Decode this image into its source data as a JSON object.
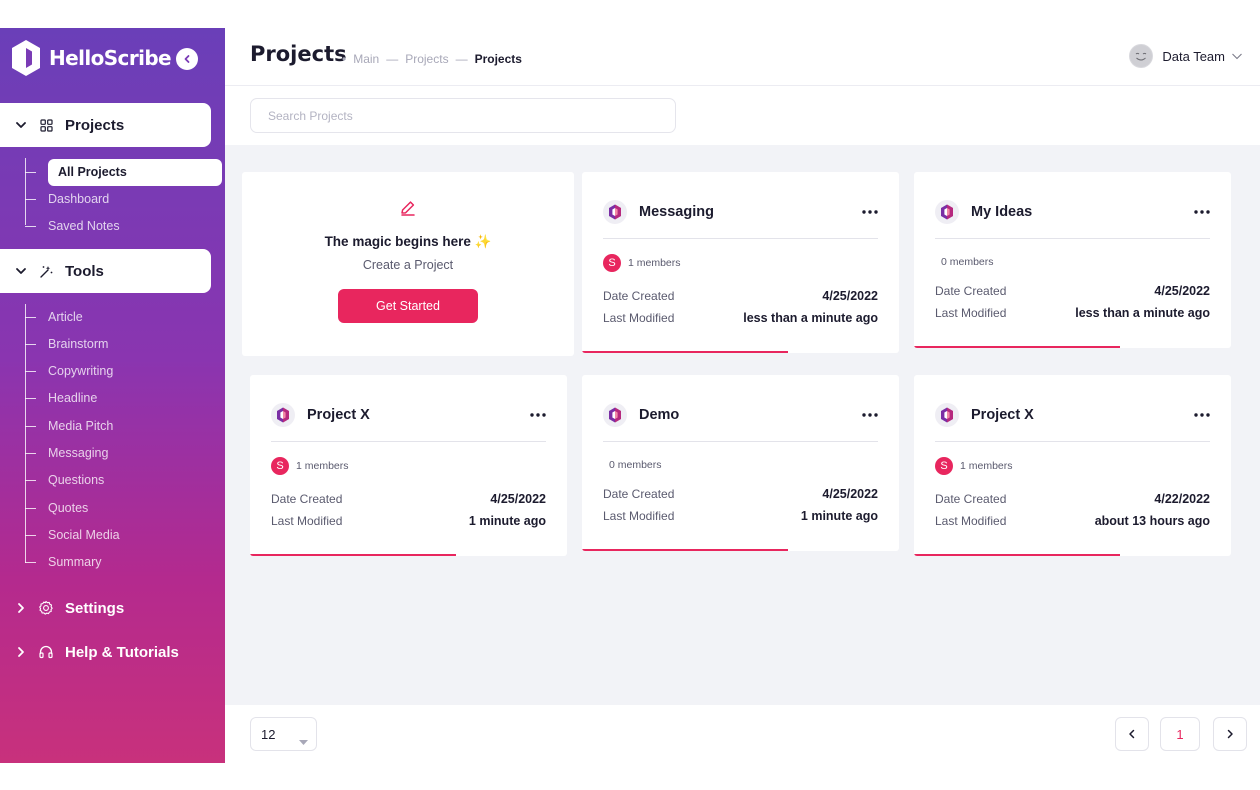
{
  "brand": {
    "name": "HelloScribe"
  },
  "colors": {
    "accent": "#e8265e",
    "sidebar_top": "#6a3fb8",
    "sidebar_bottom": "#c8317c"
  },
  "sidebar": {
    "projects": {
      "label": "Projects",
      "icon": "grid-icon",
      "items": [
        {
          "label": "All Projects",
          "active": true
        },
        {
          "label": "Dashboard"
        },
        {
          "label": "Saved Notes"
        }
      ]
    },
    "tools": {
      "label": "Tools",
      "icon": "magic-wand-icon",
      "items": [
        {
          "label": "Article"
        },
        {
          "label": "Brainstorm"
        },
        {
          "label": "Copywriting"
        },
        {
          "label": "Headline"
        },
        {
          "label": "Media Pitch"
        },
        {
          "label": "Messaging"
        },
        {
          "label": "Questions"
        },
        {
          "label": "Quotes"
        },
        {
          "label": "Social Media"
        },
        {
          "label": "Summary"
        }
      ]
    },
    "settings": {
      "label": "Settings",
      "icon": "gear-icon"
    },
    "help": {
      "label": "Help & Tutorials",
      "icon": "headset-icon"
    }
  },
  "header": {
    "title": "Projects",
    "breadcrumb": [
      "Main",
      "Projects",
      "Projects"
    ],
    "user": {
      "name": "Data Team",
      "avatar_icon": "smiley-avatar-icon"
    }
  },
  "search": {
    "placeholder": "Search Projects",
    "value": ""
  },
  "create_card": {
    "icon": "pencil-icon",
    "title": "The magic begins here",
    "sparkle": "✨",
    "subtitle": "Create a Project",
    "button": "Get Started"
  },
  "projects": [
    {
      "name": "Messaging",
      "members": "1 members",
      "member_initial": "S",
      "date_label": "Date Created",
      "date": "4/25/2022",
      "modified_label": "Last Modified",
      "modified": "less than a minute ago",
      "progress": 0.65
    },
    {
      "name": "My Ideas",
      "members": "0 members",
      "member_initial": "",
      "date_label": "Date Created",
      "date": "4/25/2022",
      "modified_label": "Last Modified",
      "modified": "less than a minute ago",
      "progress": 0.65
    },
    {
      "name": "Project X",
      "members": "1 members",
      "member_initial": "S",
      "date_label": "Date Created",
      "date": "4/25/2022",
      "modified_label": "Last Modified",
      "modified": "1 minute ago",
      "progress": 0.65
    },
    {
      "name": "Demo",
      "members": "0 members",
      "member_initial": "",
      "date_label": "Date Created",
      "date": "4/25/2022",
      "modified_label": "Last Modified",
      "modified": "1 minute ago",
      "progress": 0.65
    },
    {
      "name": "Project X",
      "members": "1 members",
      "member_initial": "S",
      "date_label": "Date Created",
      "date": "4/22/2022",
      "modified_label": "Last Modified",
      "modified": "about 13 hours ago",
      "progress": 0.65
    }
  ],
  "pagination": {
    "per_page": "12",
    "current_page": "1"
  }
}
